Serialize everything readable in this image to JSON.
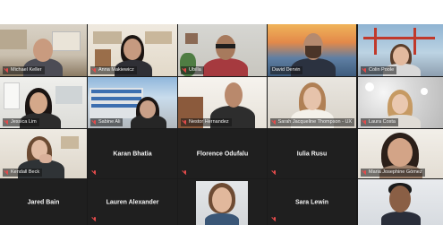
{
  "meeting": {
    "speaker_color": "#e2d44a",
    "muted_icon_color": "#e34b4b"
  },
  "participants": [
    {
      "name": "Michael Keller",
      "video": true
    },
    {
      "name": "Anna Makiewicz",
      "video": true
    },
    {
      "name": "Ubilla",
      "video": true
    },
    {
      "name": "David Dervin",
      "video": true,
      "speaking": true
    },
    {
      "name": "Colin Poole",
      "video": true
    },
    {
      "name": "Jessica Lim",
      "video": true
    },
    {
      "name": "Sabine Ali",
      "video": true
    },
    {
      "name": "Nestor Hernandez",
      "video": true
    },
    {
      "name": "Sarah Jacqueline Thompson - UX",
      "video": true
    },
    {
      "name": "Laura Costa",
      "video": true
    },
    {
      "name": "Kendall Beck",
      "video": true
    },
    {
      "name": "Karan Bhatia",
      "video": false
    },
    {
      "name": "Florence Odufalu",
      "video": false
    },
    {
      "name": "Iulia Rusu",
      "video": false
    },
    {
      "name": "Maria Josephine Gómez",
      "video": true
    },
    {
      "name": "Jared Bain",
      "video": false
    },
    {
      "name": "Lauren Alexander",
      "video": false
    },
    {
      "name": "",
      "video": true
    },
    {
      "name": "Sara Lewin",
      "video": false
    },
    {
      "name": "",
      "video": true
    }
  ]
}
